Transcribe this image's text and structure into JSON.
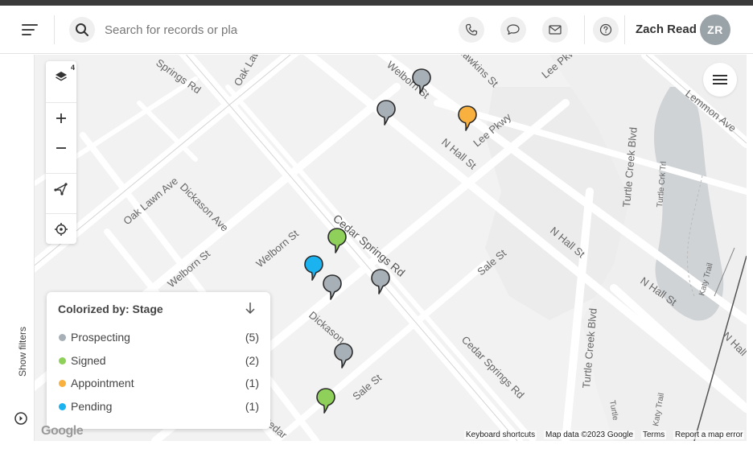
{
  "header": {
    "search_placeholder": "Search for records or places",
    "user_name": "Zach Read",
    "user_initials": "ZR"
  },
  "left_rail": {
    "show_filters_label": "Show filters"
  },
  "map_controls": {
    "layer_count": "4"
  },
  "legend": {
    "title": "Colorized by: Stage",
    "items": [
      {
        "label": "Prospecting",
        "count": "(5)",
        "color": "#a7b0b6"
      },
      {
        "label": "Signed",
        "count": "(2)",
        "color": "#8fd05b"
      },
      {
        "label": "Appointment",
        "count": "(1)",
        "color": "#f8b03e"
      },
      {
        "label": "Pending",
        "count": "(1)",
        "color": "#1ab3f0"
      }
    ]
  },
  "pins": [
    {
      "stage": "Prospecting",
      "color": "#a7b0b6"
    },
    {
      "stage": "Prospecting",
      "color": "#a7b0b6"
    },
    {
      "stage": "Appointment",
      "color": "#f8b03e"
    },
    {
      "stage": "Signed",
      "color": "#8fd05b"
    },
    {
      "stage": "Pending",
      "color": "#1ab3f0"
    },
    {
      "stage": "Prospecting",
      "color": "#a7b0b6"
    },
    {
      "stage": "Prospecting",
      "color": "#a7b0b6"
    },
    {
      "stage": "Prospecting",
      "color": "#a7b0b6"
    },
    {
      "stage": "Signed",
      "color": "#8fd05b"
    }
  ],
  "streets": [
    "Springs Rd",
    "Oak Law",
    "Welborn St",
    "Hawkins St",
    "Lee Pkwy",
    "Lemmon Ave",
    "Lee Pkwy",
    "N Hall St",
    "Turtle Creek Blvd",
    "Turtle Crk Trl",
    "Oak Lawn Ave",
    "Dickason Ave",
    "Cedar Springs Rd",
    "N Hall St",
    "Welborn St",
    "Sale St",
    "Katy Trail",
    "N Hall St",
    "N Hall",
    "Dickason",
    "Sale St",
    "Cedar Springs Rd",
    "Turtle Creek Blvd",
    "Katy Trail",
    "Welborn St",
    "Turtle",
    "Cedar"
  ],
  "attribution": {
    "google": "Google",
    "keyboard": "Keyboard shortcuts",
    "map_data": "Map data ©2023 Google",
    "terms": "Terms",
    "report": "Report a map error"
  },
  "icons": [
    "menu-icon",
    "search-icon",
    "phone-icon",
    "chat-icon",
    "mail-icon",
    "help-icon",
    "layers-icon",
    "plus-icon",
    "minus-icon",
    "draw-polygon-icon",
    "locate-icon",
    "map-menu-icon",
    "sort-down-icon",
    "filter-circle-icon"
  ]
}
